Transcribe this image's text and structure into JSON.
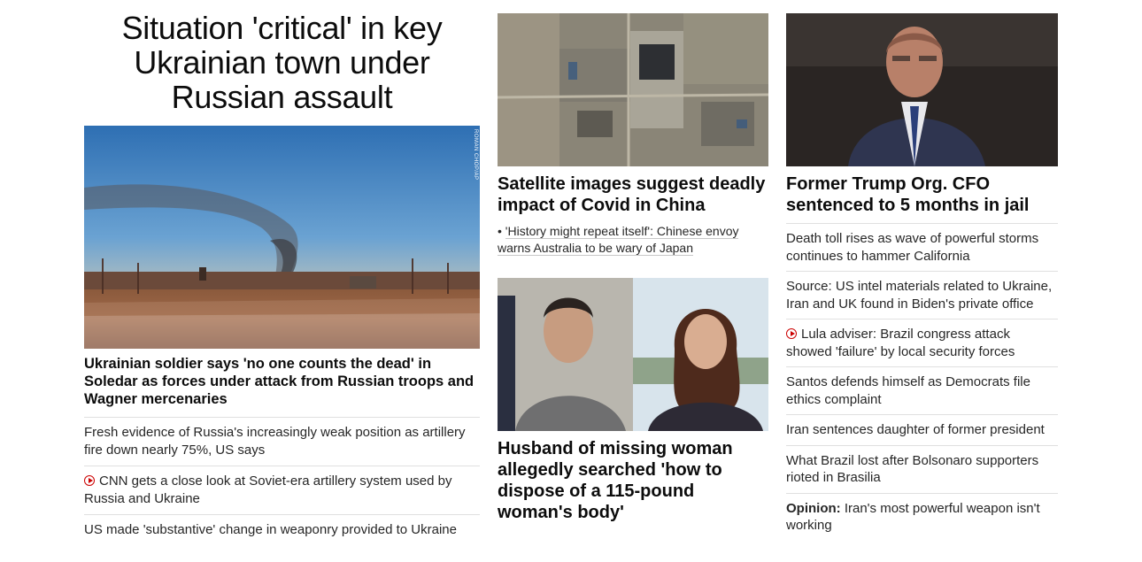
{
  "col1": {
    "headline": "Situation 'critical' in key Ukrainian town under Russian assault",
    "photo_credit": "ROMAN CHOP/AP",
    "lead_title": "Ukrainian soldier says 'no one counts the dead' in Soledar as forces under attack from Russian troops and Wagner mercenaries",
    "links": [
      "Fresh evidence of Russia's increasingly weak position as artillery fire down nearly 75%, US says",
      "CNN gets a close look at Soviet-era artillery system used by Russia and Ukraine",
      "US made 'substantive' change in weaponry provided to Ukraine"
    ]
  },
  "col2": {
    "card1_title": "Satellite images suggest deadly impact of Covid in China",
    "card1_sublink": "'History might repeat itself': Chinese envoy warns Australia to be wary of Japan",
    "card2_title": "Husband of missing woman allegedly searched 'how to dispose of a 115-pound woman's body'"
  },
  "col3": {
    "card_title": "Former Trump Org. CFO sentenced to 5 months in jail",
    "links": [
      "Death toll rises as wave of powerful storms continues to hammer California",
      "Source: US intel materials related to Ukraine, Iran and UK found in Biden's private office",
      "Lula adviser: Brazil congress attack showed 'failure' by local security forces",
      "Santos defends himself as Democrats file ethics complaint",
      "Iran sentences daughter of former president",
      "What Brazil lost after Bolsonaro supporters rioted in Brasilia"
    ],
    "opinion_label": "Opinion:",
    "opinion_text": "Iran's most powerful weapon isn't working"
  },
  "icons": {
    "video": "play-circle-icon"
  },
  "colors": {
    "accent": "#cc0000",
    "text": "#0c0c0c",
    "divider": "#e0e0e0"
  }
}
